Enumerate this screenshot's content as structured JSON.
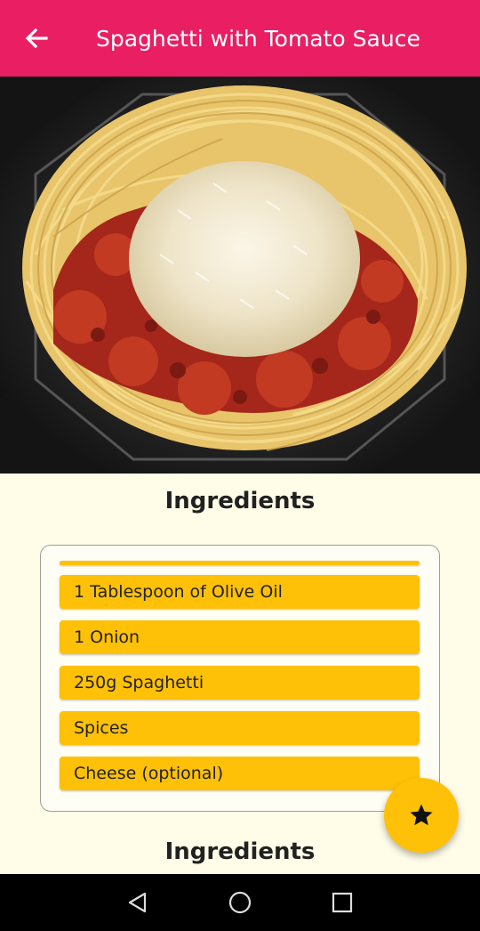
{
  "appbar": {
    "title": "Spaghetti with Tomato Sauce",
    "back_icon": "arrow-back-icon",
    "color": "#e91e63"
  },
  "hero": {
    "image": "spaghetti-with-tomato-sauce-photo"
  },
  "ingredients_section": {
    "heading": "Ingredients",
    "items": [
      "1 Tablespoon of Olive Oil",
      "1 Onion",
      "250g Spaghetti",
      "Spices",
      "Cheese (optional)"
    ],
    "item_color": "#ffc107"
  },
  "second_section": {
    "heading": "Ingredients"
  },
  "fab": {
    "icon": "star-icon",
    "color": "#ffc107"
  },
  "navbar": {
    "back": "nav-back-icon",
    "home": "nav-home-icon",
    "recents": "nav-recents-icon"
  }
}
